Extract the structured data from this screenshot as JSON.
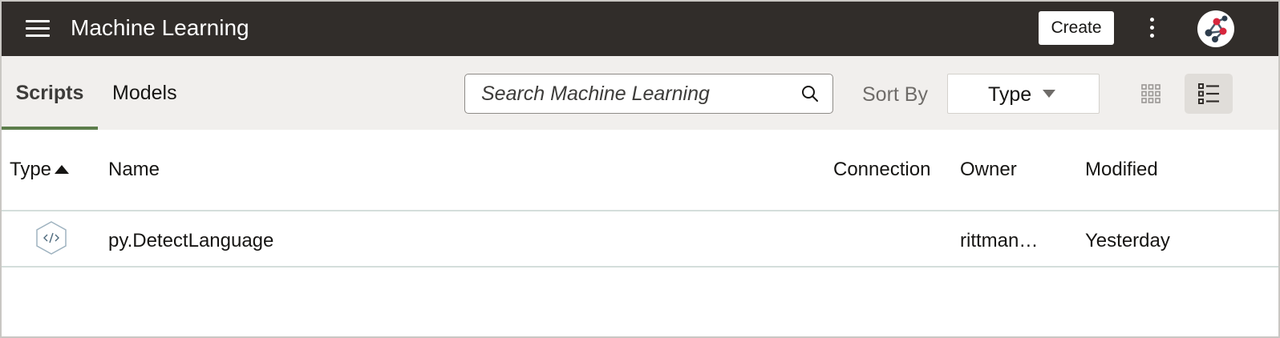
{
  "header": {
    "app_title": "Machine Learning",
    "create_label": "Create"
  },
  "tabs": [
    {
      "label": "Scripts",
      "active": true
    },
    {
      "label": "Models",
      "active": false
    }
  ],
  "search": {
    "placeholder": "Search Machine Learning",
    "value": ""
  },
  "sort": {
    "label": "Sort By",
    "value": "Type"
  },
  "view_mode": "list",
  "table": {
    "columns": [
      "Type",
      "Name",
      "Connection",
      "Owner",
      "Modified"
    ],
    "sorted_column": "Type",
    "sort_direction": "ascending",
    "rows": [
      {
        "type_icon": "script-code-icon",
        "name": "py.DetectLanguage",
        "connection": "",
        "owner": "rittman…",
        "modified": "Yesterday"
      }
    ]
  },
  "colors": {
    "header_bg": "#312d2a",
    "toolbar_bg": "#f1efed",
    "active_tab_underline": "#5c7d4b",
    "view_active_bg": "#e0ddd9"
  }
}
